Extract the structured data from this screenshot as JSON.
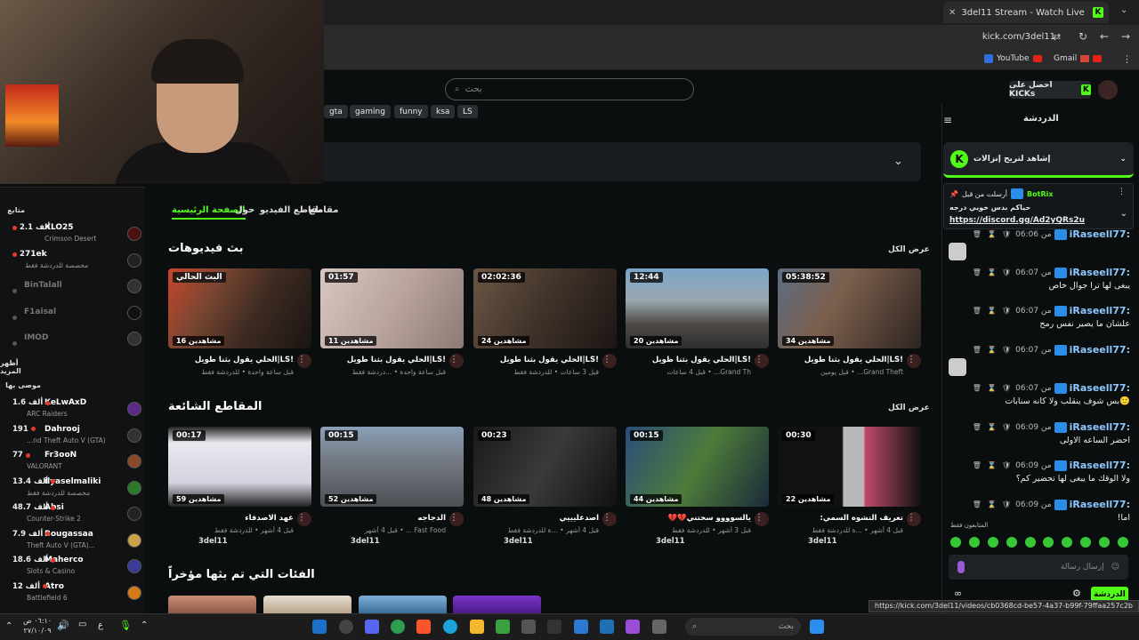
{
  "browser": {
    "tab_title": "3del11 Stream - Watch Live on",
    "url": "kick.com/3del11",
    "bookmarks": [
      {
        "label": "YouTube"
      },
      {
        "label": "Gmail"
      }
    ],
    "status_url": "https://kick.com/3del11/videos/cb0368cd-be57-4a37-b99f-79ffaa257c2b"
  },
  "header": {
    "search_placeholder": "بحث",
    "kicks_label": "احصل على KICKs"
  },
  "tags": [
    "gta",
    "gaming",
    "funny",
    "ksa",
    "LS"
  ],
  "channel_tabs": {
    "home": "الصفحة الرئيسية",
    "about": "حول",
    "videos": "مقاطع الفيديو",
    "clips": "مقاطع"
  },
  "sidebar": {
    "following_header": "متابع",
    "show_more": "أظهر المزيد",
    "recommended_header": "موصى بها",
    "following": [
      {
        "name": "KLO25",
        "sub": "Crimson Desert",
        "count": "2.1 ألف",
        "live": true
      },
      {
        "name": "71ek",
        "sub": "مخصصة للدردشة فقط",
        "count": "2",
        "live": true
      },
      {
        "name": "BinTalall",
        "sub": "",
        "count": "",
        "live": false
      },
      {
        "name": "F1aisal",
        "sub": "",
        "count": "",
        "live": false
      },
      {
        "name": "IMOD",
        "sub": "",
        "count": "",
        "live": false
      }
    ],
    "recommended": [
      {
        "name": "KeLwAxD",
        "sub": "ARC Raiders",
        "count": "1.6 ألف"
      },
      {
        "name": "Dahrooj",
        "sub": "...nd Theft Auto V (GTA)",
        "count": "191"
      },
      {
        "name": "Fr3ooN",
        "sub": "VALORANT",
        "count": "77"
      },
      {
        "name": "ilyaselmaliki",
        "sub": "مخصصة للدردشة فقط",
        "count": "13.4 ألف"
      },
      {
        "name": "Absi",
        "sub": "Counter-Strike 2",
        "count": "48.7 ألف"
      },
      {
        "name": "Bougassaa",
        "sub": "Theft Auto V (GTA)...",
        "count": "7.9 ألف"
      },
      {
        "name": "Maherco",
        "sub": "Slots & Casino",
        "count": "18.6 ألف"
      },
      {
        "name": "Atro",
        "sub": "Battlefield 6",
        "count": "12 ألف"
      }
    ]
  },
  "videos_section": {
    "title": "بث فيديوهات",
    "view_all": "عرض الكل",
    "items": [
      {
        "duration": "البث الحالي",
        "views": "16 مشاهدين",
        "title": "الحلي يقول بثنا طويل|LS!",
        "meta": "قبل ساعة واحدة • للدردشة فقط"
      },
      {
        "duration": "01:57",
        "views": "11 مشاهدين",
        "title": "الحلي يقول بثنا طويل|LS!",
        "meta": "قبل ساعة واحدة • ...دردشة فقط"
      },
      {
        "duration": "02:02:36",
        "views": "24 مشاهدين",
        "title": "الحلي يقول بثنا طويل|LS!",
        "meta": "قبل 3 ساعات • للدردشة فقط"
      },
      {
        "duration": "12:44",
        "views": "20 مشاهدين",
        "title": "الحلي يقول بثنا طويل|LS!",
        "meta": "قبل 4 ساعات • ...Grand Th"
      },
      {
        "duration": "05:38:52",
        "views": "34 مشاهدين",
        "title": "الحلي يقول بثنا طويل|LS!",
        "meta": "قبل يومين • ...Grand Theft"
      }
    ]
  },
  "clips_section": {
    "title": "المقاطع الشائعة",
    "view_all": "عرض الكل",
    "items": [
      {
        "duration": "00:17",
        "views": "59 مشاهدين",
        "title": "عهد الاصدقاء",
        "meta": "قبل 4 أشهر • للدردشة فقط",
        "channel": "3del11"
      },
      {
        "duration": "00:15",
        "views": "52 مشاهدين",
        "title": "الدجاجه",
        "meta": "قبل 4 أشهر • ... Fast Food",
        "channel": "3del11"
      },
      {
        "duration": "00:23",
        "views": "48 مشاهدين",
        "title": "اصدعليييي",
        "meta": "قبل 4 أشهر • ...ة للدردشة فقط",
        "channel": "3del11"
      },
      {
        "duration": "00:15",
        "views": "44 مشاهدين",
        "title": "💔💔يالسوووو سحتني",
        "meta": "قبل 3 أشهر • للدردشة فقط",
        "channel": "3del11"
      },
      {
        "duration": "00:30",
        "views": "22 مشاهدين",
        "title": ":تعريف التشوه السمي",
        "meta": "قبل 4 أشهر • ...ة للدردشة فقط",
        "channel": "3del11"
      }
    ]
  },
  "categories_section": {
    "title": "الفئات التي تم بثها مؤخراً"
  },
  "chat": {
    "title": "الدردشة",
    "pin_banner": "إشاهد لتريح إنزالات",
    "pinned": {
      "sent_by": "أرسلت من قبل",
      "bot": "BotRix",
      "text": "حياكم بدس خويي درجه",
      "link": "https://discord.gg/Ad2yQRs2u"
    },
    "messages": [
      {
        "user": "iRaseell77:",
        "time": "من 06:06",
        "text": ""
      },
      {
        "user": "iRaseell77:",
        "time": "من 06:07",
        "text": "يبغى لها ترا جوال خاص"
      },
      {
        "user": "iRaseell77:",
        "time": "من 06:07",
        "text": "علشان ما يصير نفس رمح"
      },
      {
        "user": "iRaseell77:",
        "time": "من 06:07",
        "text": ""
      },
      {
        "user": "iRaseell77:",
        "time": "من 06:07",
        "text": "بس شوف ينقلب ولا كانه سنابات🙂"
      },
      {
        "user": "iRaseell77:",
        "time": "من 06:09",
        "text": "احضر الساعه الاولى"
      },
      {
        "user": "iRaseell77:",
        "time": "من 06:09",
        "text": "ولا الوقك ما يبغى لها تحضير كم؟"
      },
      {
        "user": "iRaseell77:",
        "time": "من 06:09",
        "text": "!اما"
      }
    ],
    "followers_only": "المتابعون فقط",
    "input_placeholder": "إرسال رسالة",
    "send_label": "الدردشة"
  },
  "taskbar": {
    "search_placeholder": "بحث",
    "time": "٠٦:١٠ ص",
    "date": "٢٧/١٠/٠٩",
    "lang": "ع"
  },
  "colors": {
    "accent": "#53fc18",
    "live": "#e5392b",
    "username": "#8ec8ff"
  }
}
